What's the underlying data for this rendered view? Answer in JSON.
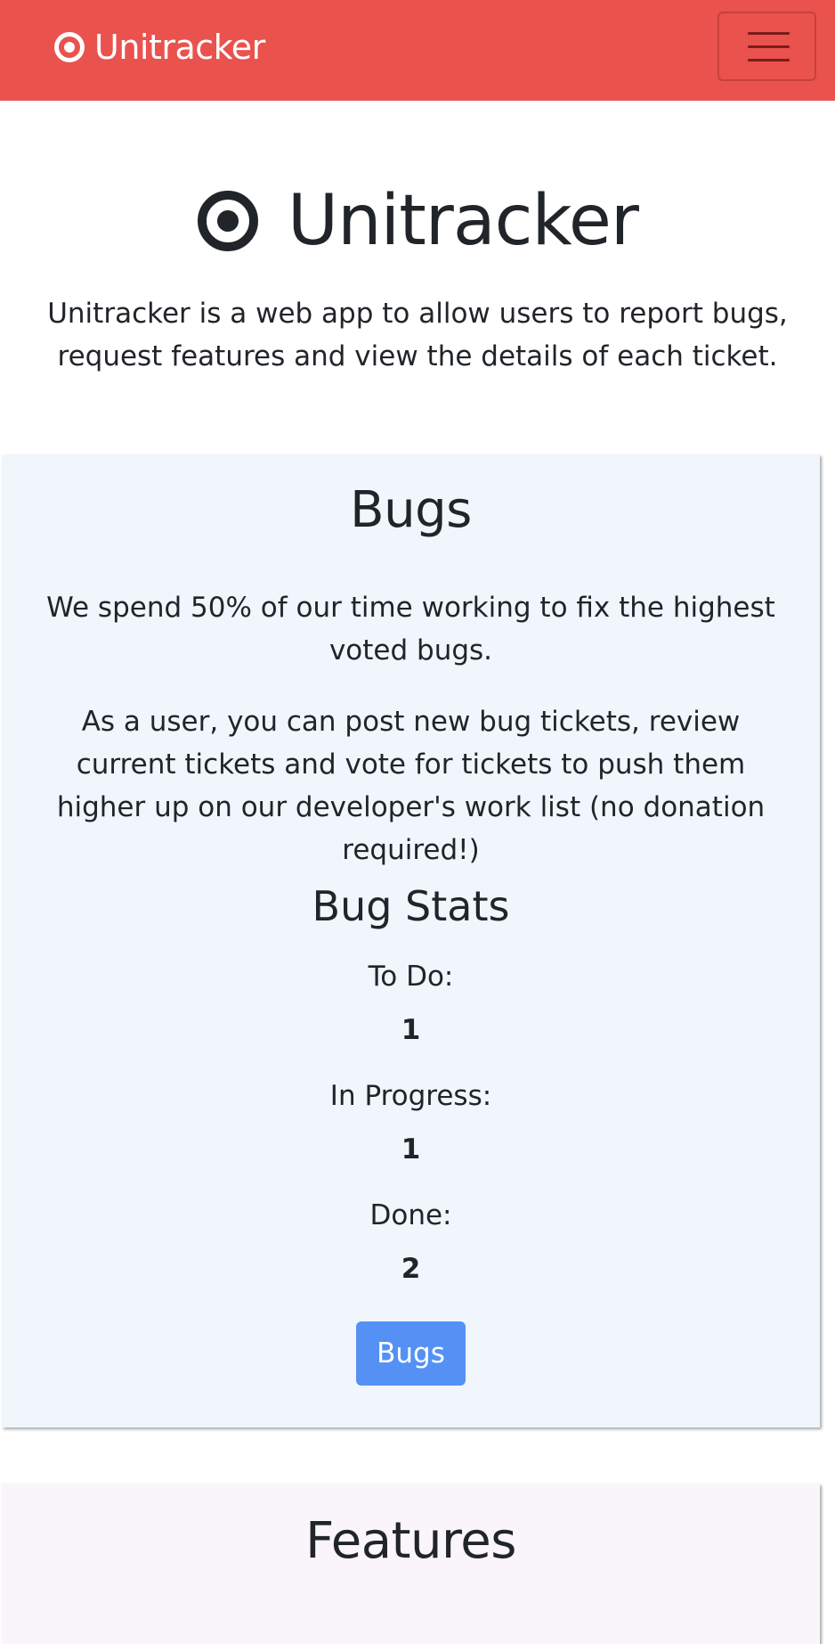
{
  "navbar": {
    "brand_label": "Unitracker",
    "brand_icon": "bullseye-icon",
    "toggler_icon": "hamburger-menu-icon"
  },
  "hero": {
    "title": "Unitracker",
    "icon": "bullseye-icon",
    "description": "Unitracker is a web app to allow users to report bugs, request features and view the details of each ticket."
  },
  "bugs": {
    "title": "Bugs",
    "paragraph1": "We spend 50% of our time working to fix the highest voted bugs.",
    "paragraph2": "As a user, you can post new bug tickets, review current tickets and vote for tickets to push them higher up on our developer's work list (no donation required!)",
    "stats_title": "Bug Stats",
    "stats": [
      {
        "label": "To Do:",
        "value": "1"
      },
      {
        "label": "In Progress:",
        "value": "1"
      },
      {
        "label": "Done:",
        "value": "2"
      }
    ],
    "button_label": "Bugs"
  },
  "features": {
    "title": "Features"
  },
  "colors": {
    "navbar": "#ea524d",
    "primary_button": "#5591f4",
    "bugs_card_bg": "#f1f6fd",
    "features_card_bg": "#f9f5fb",
    "text": "#212529"
  }
}
